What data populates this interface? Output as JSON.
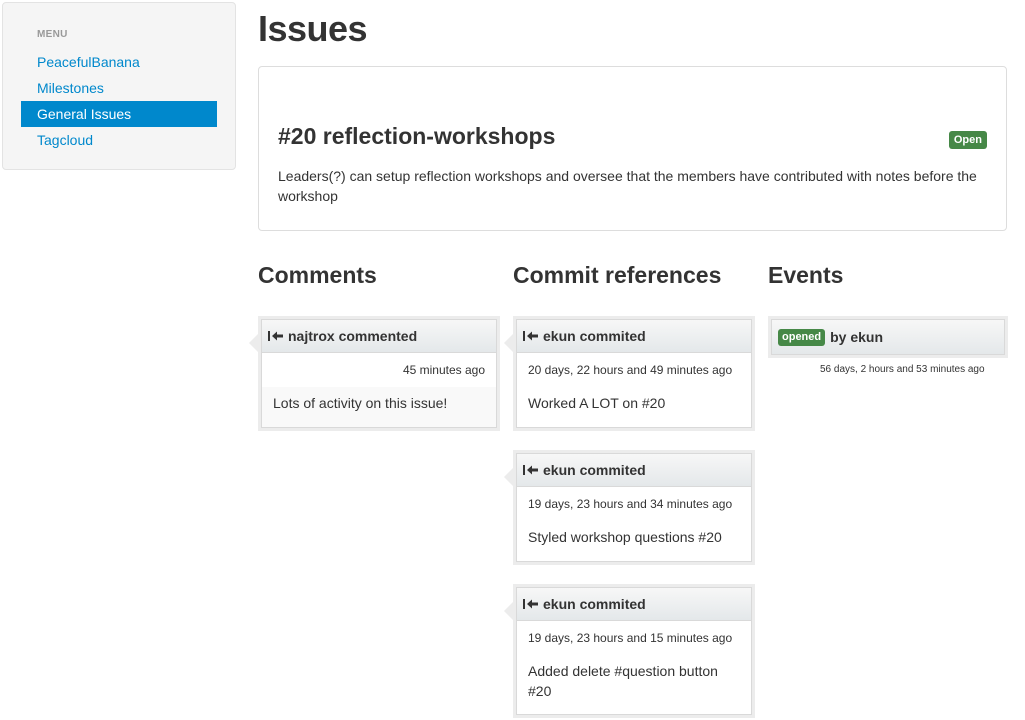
{
  "sidebar": {
    "header": "MENU",
    "items": [
      {
        "label": "PeacefulBanana"
      },
      {
        "label": "Milestones"
      },
      {
        "label": "General Issues"
      },
      {
        "label": "Tagcloud"
      }
    ],
    "active_index": 2
  },
  "page": {
    "title": "Issues"
  },
  "issue": {
    "title": "#20 reflection-workshops",
    "status": "Open",
    "description": "Leaders(?) can setup reflection workshops and oversee that the members have contributed with notes before the workshop"
  },
  "sections": {
    "comments": "Comments",
    "commits": "Commit references",
    "events": "Events"
  },
  "comments": [
    {
      "author_line": "najtrox commented",
      "time": "45 minutes ago",
      "body": "Lots of activity on this issue!"
    }
  ],
  "commits": [
    {
      "author_line": "ekun commited",
      "time": "20 days, 22 hours and 49 minutes ago",
      "body": "Worked A LOT on #20"
    },
    {
      "author_line": "ekun commited",
      "time": "19 days, 23 hours and 34 minutes ago",
      "body": "Styled workshop questions #20"
    },
    {
      "author_line": "ekun commited",
      "time": "19 days, 23 hours and 15 minutes ago",
      "body": "Added delete #question button #20"
    }
  ],
  "events": [
    {
      "badge": "opened",
      "by": "by ekun",
      "time": "56 days, 2 hours and 53 minutes ago"
    }
  ],
  "colors": {
    "accent": "#0088cc",
    "success": "#468847"
  }
}
